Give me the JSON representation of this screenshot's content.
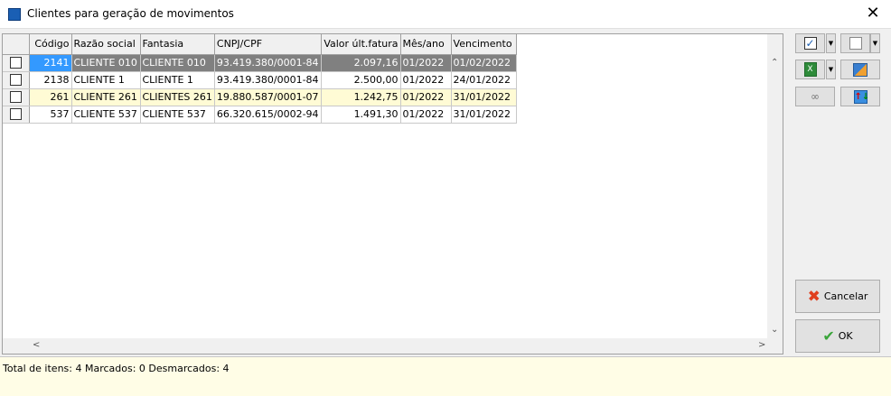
{
  "window": {
    "title": "Clientes para geração de movimentos",
    "close": "✕"
  },
  "grid": {
    "columns": [
      "Código",
      "Razão social",
      "Fantasia",
      "CNPJ/CPF",
      "Valor últ.fatura",
      "Mês/ano",
      "Vencimento"
    ],
    "rows": [
      {
        "checked": false,
        "codigo": "2141",
        "razao": "CLIENTE 010",
        "fantasia": "CLIENTE 010",
        "cnpj": "93.419.380/0001-84",
        "valor": "2.097,16",
        "mes": "01/2022",
        "venc": "01/02/2022",
        "selected": true
      },
      {
        "checked": false,
        "codigo": "2138",
        "razao": "CLIENTE 1",
        "fantasia": "CLIENTE 1",
        "cnpj": "93.419.380/0001-84",
        "valor": "2.500,00",
        "mes": "01/2022",
        "venc": "24/01/2022"
      },
      {
        "checked": false,
        "codigo": "261",
        "razao": "CLIENTE 261",
        "fantasia": "CLIENTES 261",
        "cnpj": "19.880.587/0001-07",
        "valor": "1.242,75",
        "mes": "01/2022",
        "venc": "31/01/2022"
      },
      {
        "checked": false,
        "codigo": "537",
        "razao": "CLIENTE 537",
        "fantasia": "CLIENTE 537",
        "cnpj": "66.320.615/0002-94",
        "valor": "1.491,30",
        "mes": "01/2022",
        "venc": "31/01/2022"
      }
    ]
  },
  "buttons": {
    "cancel": "Cancelar",
    "ok": "OK"
  },
  "status": "Total de itens: 4 Marcados: 0 Desmarcados: 4",
  "colors": {
    "selected_row": "#808080",
    "selected_cell": "#3399ff",
    "alt_row": "#fffbd5",
    "status_bg": "#fffde6"
  }
}
